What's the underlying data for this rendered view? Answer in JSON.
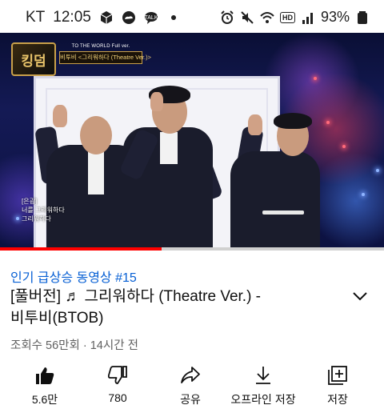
{
  "status_bar": {
    "carrier": "KT",
    "time": "12:05",
    "battery": "93%",
    "left_icons": [
      "cube-icon",
      "cloud-icon",
      "chat-icon",
      "dot-icon"
    ],
    "right_icons": [
      "alarm-icon",
      "mute-icon",
      "wifi-icon",
      "hd-badge",
      "signal-icon",
      "battery-icon"
    ],
    "hd_label": "HD"
  },
  "video": {
    "show_logo_text": "킹덤",
    "caption_small": "TO THE WORLD Full ver.",
    "caption_main": "비투비 <그리워하다 (Theatre Ver.)>",
    "side_lyric": [
      "[은광]",
      "너를 그리워하다",
      "그리워하다"
    ],
    "progress": 0.42,
    "accent_color": "#ff0000"
  },
  "info": {
    "trending": "인기 급상승 동영상 #15",
    "title_line1": "[풀버전] ♬ 그리워하다 (Theatre Ver.) -",
    "title_line2": "비투비(BTOB)",
    "meta": "조회수 56만회 · 14시간 전",
    "link_color": "#065fd4"
  },
  "actions": [
    {
      "icon": "thumbs-up-icon",
      "label": "5.6만"
    },
    {
      "icon": "thumbs-down-icon",
      "label": "780"
    },
    {
      "icon": "share-icon",
      "label": "공유"
    },
    {
      "icon": "download-icon",
      "label": "오프라인 저장"
    },
    {
      "icon": "save-playlist-icon",
      "label": "저장"
    }
  ]
}
